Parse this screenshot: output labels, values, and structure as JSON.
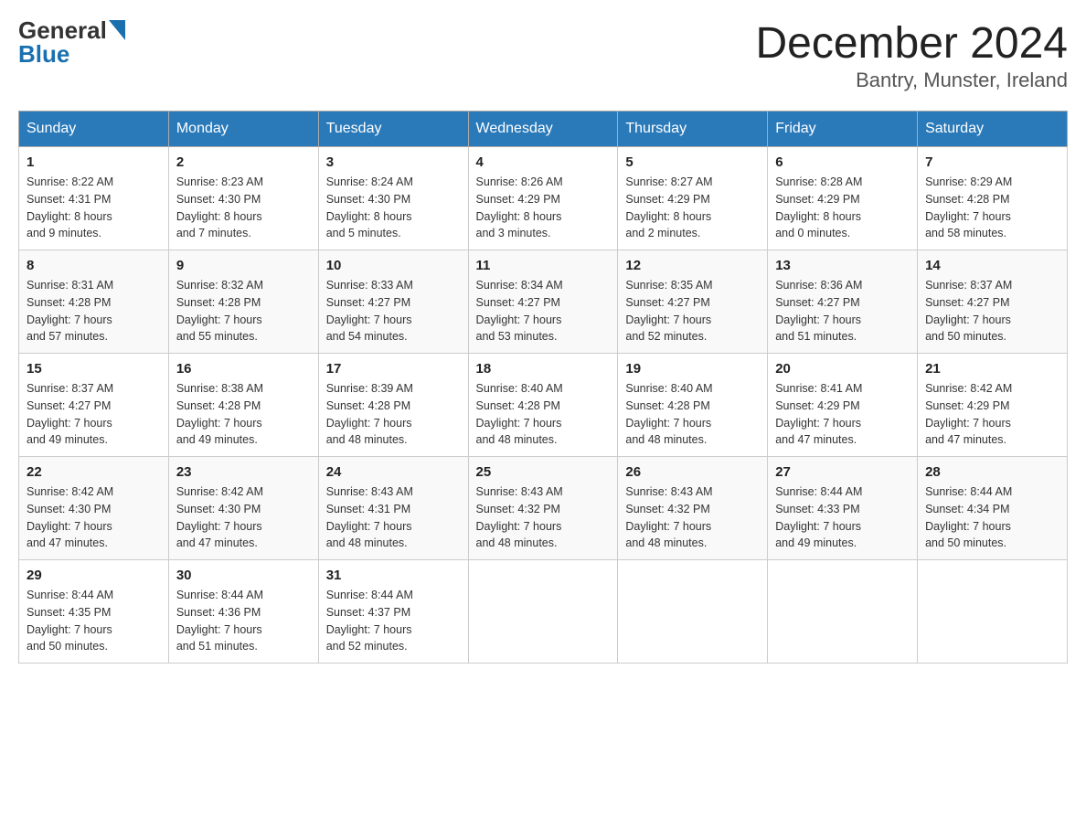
{
  "header": {
    "logo_general": "General",
    "logo_blue": "Blue",
    "month_title": "December 2024",
    "location": "Bantry, Munster, Ireland"
  },
  "days_of_week": [
    "Sunday",
    "Monday",
    "Tuesday",
    "Wednesday",
    "Thursday",
    "Friday",
    "Saturday"
  ],
  "weeks": [
    [
      {
        "day": "1",
        "sunrise": "8:22 AM",
        "sunset": "4:31 PM",
        "daylight": "8 hours and 9 minutes."
      },
      {
        "day": "2",
        "sunrise": "8:23 AM",
        "sunset": "4:30 PM",
        "daylight": "8 hours and 7 minutes."
      },
      {
        "day": "3",
        "sunrise": "8:24 AM",
        "sunset": "4:30 PM",
        "daylight": "8 hours and 5 minutes."
      },
      {
        "day": "4",
        "sunrise": "8:26 AM",
        "sunset": "4:29 PM",
        "daylight": "8 hours and 3 minutes."
      },
      {
        "day": "5",
        "sunrise": "8:27 AM",
        "sunset": "4:29 PM",
        "daylight": "8 hours and 2 minutes."
      },
      {
        "day": "6",
        "sunrise": "8:28 AM",
        "sunset": "4:29 PM",
        "daylight": "8 hours and 0 minutes."
      },
      {
        "day": "7",
        "sunrise": "8:29 AM",
        "sunset": "4:28 PM",
        "daylight": "7 hours and 58 minutes."
      }
    ],
    [
      {
        "day": "8",
        "sunrise": "8:31 AM",
        "sunset": "4:28 PM",
        "daylight": "7 hours and 57 minutes."
      },
      {
        "day": "9",
        "sunrise": "8:32 AM",
        "sunset": "4:28 PM",
        "daylight": "7 hours and 55 minutes."
      },
      {
        "day": "10",
        "sunrise": "8:33 AM",
        "sunset": "4:27 PM",
        "daylight": "7 hours and 54 minutes."
      },
      {
        "day": "11",
        "sunrise": "8:34 AM",
        "sunset": "4:27 PM",
        "daylight": "7 hours and 53 minutes."
      },
      {
        "day": "12",
        "sunrise": "8:35 AM",
        "sunset": "4:27 PM",
        "daylight": "7 hours and 52 minutes."
      },
      {
        "day": "13",
        "sunrise": "8:36 AM",
        "sunset": "4:27 PM",
        "daylight": "7 hours and 51 minutes."
      },
      {
        "day": "14",
        "sunrise": "8:37 AM",
        "sunset": "4:27 PM",
        "daylight": "7 hours and 50 minutes."
      }
    ],
    [
      {
        "day": "15",
        "sunrise": "8:37 AM",
        "sunset": "4:27 PM",
        "daylight": "7 hours and 49 minutes."
      },
      {
        "day": "16",
        "sunrise": "8:38 AM",
        "sunset": "4:28 PM",
        "daylight": "7 hours and 49 minutes."
      },
      {
        "day": "17",
        "sunrise": "8:39 AM",
        "sunset": "4:28 PM",
        "daylight": "7 hours and 48 minutes."
      },
      {
        "day": "18",
        "sunrise": "8:40 AM",
        "sunset": "4:28 PM",
        "daylight": "7 hours and 48 minutes."
      },
      {
        "day": "19",
        "sunrise": "8:40 AM",
        "sunset": "4:28 PM",
        "daylight": "7 hours and 48 minutes."
      },
      {
        "day": "20",
        "sunrise": "8:41 AM",
        "sunset": "4:29 PM",
        "daylight": "7 hours and 47 minutes."
      },
      {
        "day": "21",
        "sunrise": "8:42 AM",
        "sunset": "4:29 PM",
        "daylight": "7 hours and 47 minutes."
      }
    ],
    [
      {
        "day": "22",
        "sunrise": "8:42 AM",
        "sunset": "4:30 PM",
        "daylight": "7 hours and 47 minutes."
      },
      {
        "day": "23",
        "sunrise": "8:42 AM",
        "sunset": "4:30 PM",
        "daylight": "7 hours and 47 minutes."
      },
      {
        "day": "24",
        "sunrise": "8:43 AM",
        "sunset": "4:31 PM",
        "daylight": "7 hours and 48 minutes."
      },
      {
        "day": "25",
        "sunrise": "8:43 AM",
        "sunset": "4:32 PM",
        "daylight": "7 hours and 48 minutes."
      },
      {
        "day": "26",
        "sunrise": "8:43 AM",
        "sunset": "4:32 PM",
        "daylight": "7 hours and 48 minutes."
      },
      {
        "day": "27",
        "sunrise": "8:44 AM",
        "sunset": "4:33 PM",
        "daylight": "7 hours and 49 minutes."
      },
      {
        "day": "28",
        "sunrise": "8:44 AM",
        "sunset": "4:34 PM",
        "daylight": "7 hours and 50 minutes."
      }
    ],
    [
      {
        "day": "29",
        "sunrise": "8:44 AM",
        "sunset": "4:35 PM",
        "daylight": "7 hours and 50 minutes."
      },
      {
        "day": "30",
        "sunrise": "8:44 AM",
        "sunset": "4:36 PM",
        "daylight": "7 hours and 51 minutes."
      },
      {
        "day": "31",
        "sunrise": "8:44 AM",
        "sunset": "4:37 PM",
        "daylight": "7 hours and 52 minutes."
      },
      null,
      null,
      null,
      null
    ]
  ],
  "labels": {
    "sunrise": "Sunrise:",
    "sunset": "Sunset:",
    "daylight": "Daylight:"
  }
}
